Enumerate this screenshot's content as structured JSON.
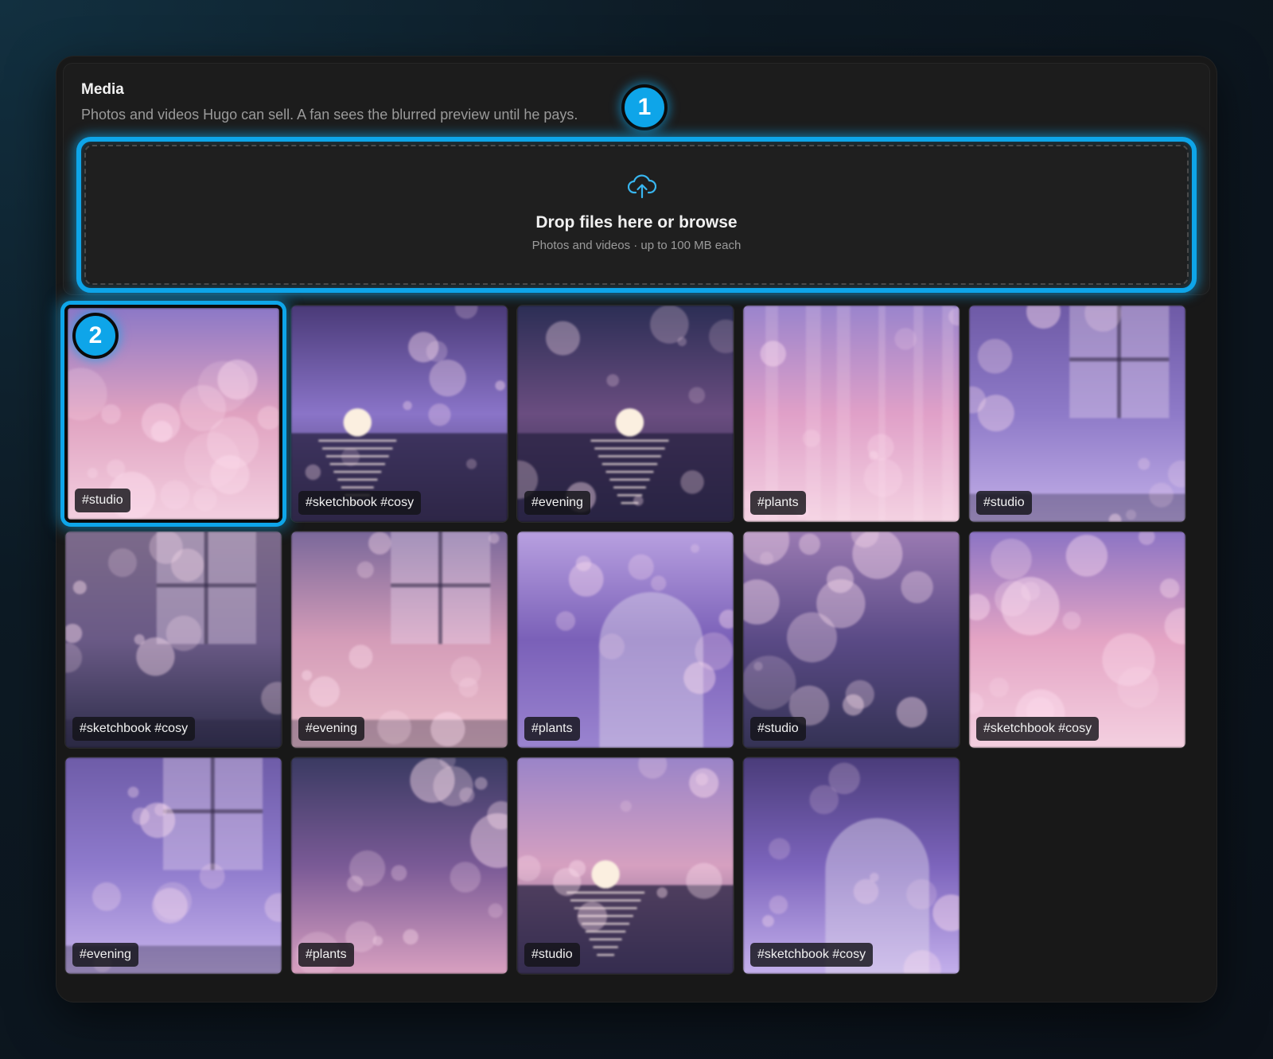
{
  "media": {
    "title": "Media",
    "subtitle": "Photos and videos Hugo can sell. A fan sees the blurred preview until he pays."
  },
  "dropzone": {
    "title": "Drop files here or browse",
    "subtitle": "Photos and videos · up to 100 MB each",
    "icon": "upload-cloud-icon"
  },
  "callouts": [
    "1",
    "2"
  ],
  "accent_color": "#0ea5e9",
  "tiles": [
    {
      "tag": "#studio",
      "scene": "bokeh",
      "palette": [
        "#8c78c6",
        "#e0a2c0",
        "#f3cfe0"
      ],
      "selected": true
    },
    {
      "tag": "#sketchbook #cosy",
      "scene": "sunset",
      "palette": [
        "#4a3a78",
        "#8a74c8",
        "#3e3456"
      ],
      "selected": false
    },
    {
      "tag": "#evening",
      "scene": "sunset",
      "palette": [
        "#2c2e55",
        "#6a4d80",
        "#2a2a48"
      ],
      "selected": false
    },
    {
      "tag": "#plants",
      "scene": "curtain",
      "palette": [
        "#9a84cc",
        "#e0a0c8",
        "#f4d2e2"
      ],
      "selected": false
    },
    {
      "tag": "#studio",
      "scene": "window",
      "palette": [
        "#6e5aa6",
        "#8e7ac8",
        "#c4b0e8"
      ],
      "selected": false
    },
    {
      "tag": "#sketchbook #cosy",
      "scene": "window",
      "palette": [
        "#7c6a8a",
        "#6a5a86",
        "#2c2c48"
      ],
      "selected": false
    },
    {
      "tag": "#evening",
      "scene": "window",
      "palette": [
        "#7a689a",
        "#d49cb8",
        "#ecc0cc"
      ],
      "selected": false
    },
    {
      "tag": "#plants",
      "scene": "arch",
      "palette": [
        "#b8a0e0",
        "#7a60b8",
        "#9a84d0"
      ],
      "selected": false
    },
    {
      "tag": "#studio",
      "scene": "bokeh",
      "palette": [
        "#9a7ab2",
        "#5a4a86",
        "#343254"
      ],
      "selected": false
    },
    {
      "tag": "#sketchbook #cosy",
      "scene": "bokeh",
      "palette": [
        "#8c74c4",
        "#e4a4c4",
        "#f4d0e0"
      ],
      "selected": false
    },
    {
      "tag": "#evening",
      "scene": "window",
      "palette": [
        "#6e5ca8",
        "#8e7acc",
        "#c8b4ec"
      ],
      "selected": false
    },
    {
      "tag": "#plants",
      "scene": "bokeh",
      "palette": [
        "#3a3a62",
        "#7a5a96",
        "#d8a0c0"
      ],
      "selected": false
    },
    {
      "tag": "#studio",
      "scene": "sunset",
      "palette": [
        "#9a84c8",
        "#d6a0c0",
        "#5a4e78"
      ],
      "selected": false
    },
    {
      "tag": "#sketchbook #cosy",
      "scene": "arch",
      "palette": [
        "#4a3c7a",
        "#7c64bc",
        "#c4b0ec"
      ],
      "selected": false
    }
  ]
}
